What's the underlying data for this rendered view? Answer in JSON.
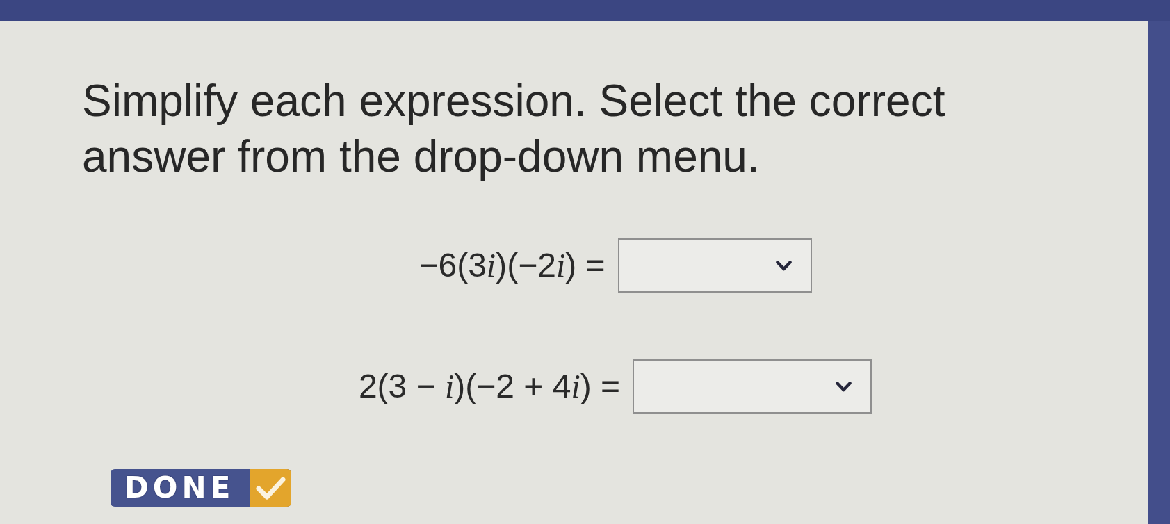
{
  "instructions": "Simplify each expression. Select the correct answer from the drop-down menu.",
  "problems": [
    {
      "expression": [
        {
          "text": "−6(3",
          "italic": false
        },
        {
          "text": "i",
          "italic": true
        },
        {
          "text": ")(−2",
          "italic": false
        },
        {
          "text": "i",
          "italic": true
        },
        {
          "text": ") =",
          "italic": false
        }
      ],
      "kind": "dropdown"
    },
    {
      "expression": [
        {
          "text": "2(3 − ",
          "italic": false
        },
        {
          "text": "i",
          "italic": true
        },
        {
          "text": ")(−2 + 4",
          "italic": false
        },
        {
          "text": "i",
          "italic": true
        },
        {
          "text": ") =",
          "italic": false
        }
      ],
      "kind": "dropdown"
    }
  ],
  "done_button": {
    "label": "DONE"
  }
}
